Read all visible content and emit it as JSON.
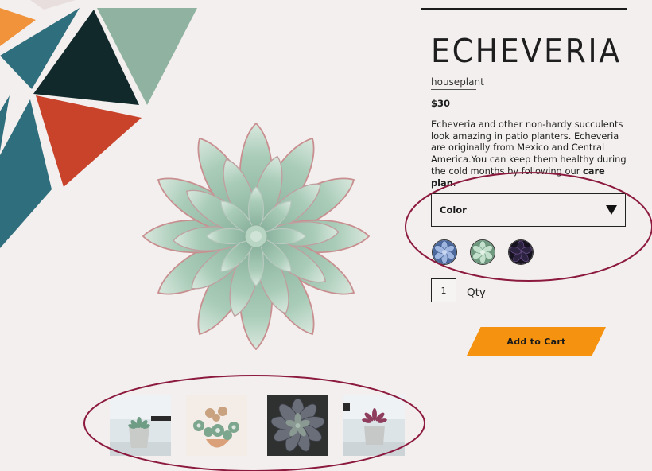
{
  "product": {
    "title": "ECHEVERIA",
    "category": "houseplant",
    "price": "$30",
    "description_text": "Echeveria and other non-hardy succulents look amazing in patio planters. Echeveria are originally from Mexico and Central America.You can keep them healthy during the cold months by following our ",
    "description_link": "care plan",
    "description_end": "."
  },
  "color_select": {
    "label": "Color",
    "icon": "chevron-down-icon"
  },
  "swatches": [
    {
      "name": "blue",
      "color": "#7a93c4"
    },
    {
      "name": "mint",
      "color": "#a8cbb0"
    },
    {
      "name": "dark-purple",
      "color": "#241c33"
    }
  ],
  "quantity": {
    "value": "1",
    "label": "Qty"
  },
  "add_to_cart": {
    "label": "Add to Cart"
  },
  "colors": {
    "background": "#f3efee",
    "accent": "#f5920f",
    "annotation": "#8c1a3f",
    "leaf": "#9fc1ad",
    "teal": "#2f6e7c",
    "dark_teal": "#12292b",
    "sage": "#8fb3a0",
    "red": "#c8432a",
    "orange": "#f0933a"
  }
}
